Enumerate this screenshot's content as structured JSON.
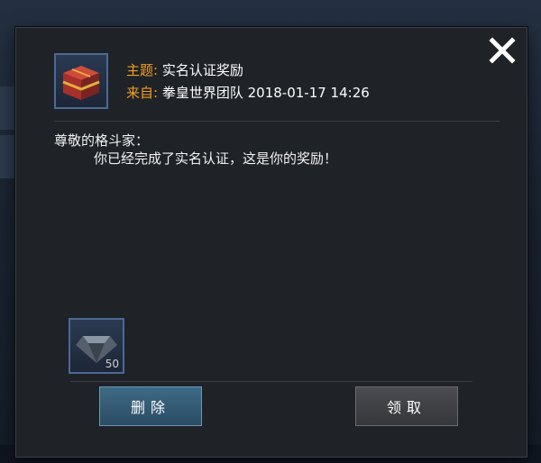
{
  "mail": {
    "subject_label": "主题:",
    "subject": "实名认证奖励",
    "from_label": "来自:",
    "from": "拳皇世界团队 2018-01-17 14:26",
    "greeting": "尊敬的格斗家：",
    "body": "你已经完成了实名认证，这是你的奖励！",
    "reward_count": "50"
  },
  "buttons": {
    "delete": "删除",
    "claim": "领取"
  },
  "icons": {
    "close": "close-icon",
    "header": "gift-box-icon",
    "reward": "diamond-icon"
  },
  "colors": {
    "label_accent": "#f0a020",
    "delete_button": "#3e6a86",
    "claim_button": "#45474b"
  }
}
